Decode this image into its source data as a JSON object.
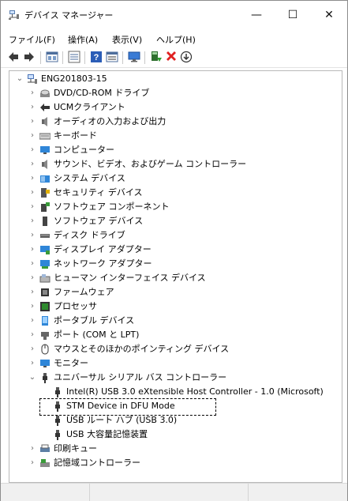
{
  "window": {
    "title": "デバイス マネージャー",
    "controls": {
      "minimize": "—",
      "maximize": "☐",
      "close": "✕"
    }
  },
  "menu": [
    "ファイル(F)",
    "操作(A)",
    "表示(V)",
    "ヘルプ(H)"
  ],
  "toolbar": [
    "back-icon",
    "forward-icon",
    "properties-icon",
    "view-icon",
    "help-icon",
    "details-icon",
    "monitor-icon",
    "update-driver-icon",
    "uninstall-icon",
    "download-icon"
  ],
  "tree": {
    "root": "ENG201803-15",
    "items": [
      {
        "label": "DVD/CD-ROM ドライブ",
        "icon": "dvd-drive-icon",
        "expanded": false
      },
      {
        "label": "UCMクライアント",
        "icon": "ucm-client-icon",
        "expanded": false
      },
      {
        "label": "オーディオの入力および出力",
        "icon": "audio-icon",
        "expanded": false
      },
      {
        "label": "キーボード",
        "icon": "keyboard-icon",
        "expanded": false
      },
      {
        "label": "コンピューター",
        "icon": "computer-icon",
        "expanded": false
      },
      {
        "label": "サウンド、ビデオ、およびゲーム コントローラー",
        "icon": "sound-icon",
        "expanded": false
      },
      {
        "label": "システム デバイス",
        "icon": "system-device-icon",
        "expanded": false
      },
      {
        "label": "セキュリティ デバイス",
        "icon": "security-device-icon",
        "expanded": false
      },
      {
        "label": "ソフトウェア コンポーネント",
        "icon": "software-component-icon",
        "expanded": false
      },
      {
        "label": "ソフトウェア デバイス",
        "icon": "software-device-icon",
        "expanded": false
      },
      {
        "label": "ディスク ドライブ",
        "icon": "disk-drive-icon",
        "expanded": false
      },
      {
        "label": "ディスプレイ アダプター",
        "icon": "display-adapter-icon",
        "expanded": false
      },
      {
        "label": "ネットワーク アダプター",
        "icon": "network-adapter-icon",
        "expanded": false
      },
      {
        "label": "ヒューマン インターフェイス デバイス",
        "icon": "hid-icon",
        "expanded": false
      },
      {
        "label": "ファームウェア",
        "icon": "firmware-icon",
        "expanded": false
      },
      {
        "label": "プロセッサ",
        "icon": "processor-icon",
        "expanded": false
      },
      {
        "label": "ポータブル デバイス",
        "icon": "portable-device-icon",
        "expanded": false
      },
      {
        "label": "ポート (COM と LPT)",
        "icon": "port-icon",
        "expanded": false
      },
      {
        "label": "マウスとそのほかのポインティング デバイス",
        "icon": "mouse-icon",
        "expanded": false
      },
      {
        "label": "モニター",
        "icon": "monitor-icon",
        "expanded": false
      },
      {
        "label": "ユニバーサル シリアル バス コントローラー",
        "icon": "usb-icon",
        "expanded": true,
        "children": [
          {
            "label": "Intel(R) USB 3.0 eXtensible Host Controller - 1.0 (Microsoft)",
            "icon": "usb-controller-icon"
          },
          {
            "label": "STM Device in DFU Mode",
            "icon": "usb-device-icon",
            "selected": true
          },
          {
            "label": "USB ルート ハブ (USB 3.0)",
            "icon": "usb-hub-icon"
          },
          {
            "label": "USB 大容量記憶装置",
            "icon": "usb-storage-icon"
          }
        ]
      },
      {
        "label": "印刷キュー",
        "icon": "print-queue-icon",
        "expanded": false
      },
      {
        "label": "記憶域コントローラー",
        "icon": "storage-controller-icon",
        "expanded": false
      }
    ]
  }
}
